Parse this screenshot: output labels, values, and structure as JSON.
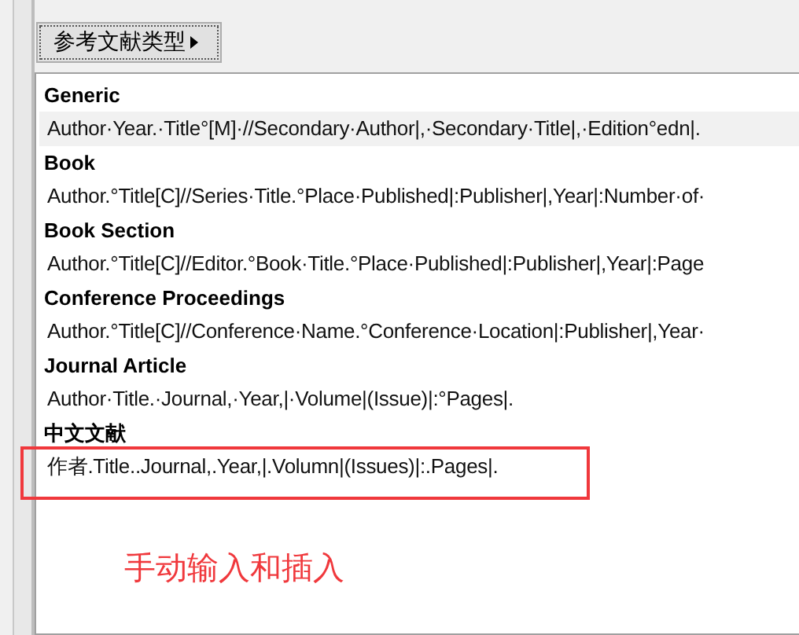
{
  "toolbar": {
    "button": "参考文献类型"
  },
  "templates": [
    {
      "name": "Generic",
      "template": "Author·Year.·Title°[M]·//Secondary·Author|,·Secondary·Title|,·Edition°edn|.",
      "highlighted": true,
      "boxed": false
    },
    {
      "name": "Book",
      "template": "Author.°Title[C]//Series·Title.°Place·Published|:Publisher|,Year|:Number·of·",
      "highlighted": false,
      "boxed": false
    },
    {
      "name": "Book Section",
      "template": "Author.°Title[C]//Editor.°Book·Title.°Place·Published|:Publisher|,Year|:Page",
      "highlighted": false,
      "boxed": false
    },
    {
      "name": "Conference Proceedings",
      "template": "Author.°Title[C]//Conference·Name.°Conference·Location|:Publisher|,Year·",
      "highlighted": false,
      "boxed": false
    },
    {
      "name": "Journal Article",
      "template": "Author·Title.·Journal,·Year,|·Volume|(Issue)|:°Pages|.",
      "highlighted": false,
      "boxed": false
    },
    {
      "name": "中文文献",
      "template": "作者.Title..Journal,.Year,|.Volumn|(Issues)|:.Pages|.",
      "highlighted": false,
      "boxed": true
    }
  ],
  "annotation": "手动输入和插入"
}
